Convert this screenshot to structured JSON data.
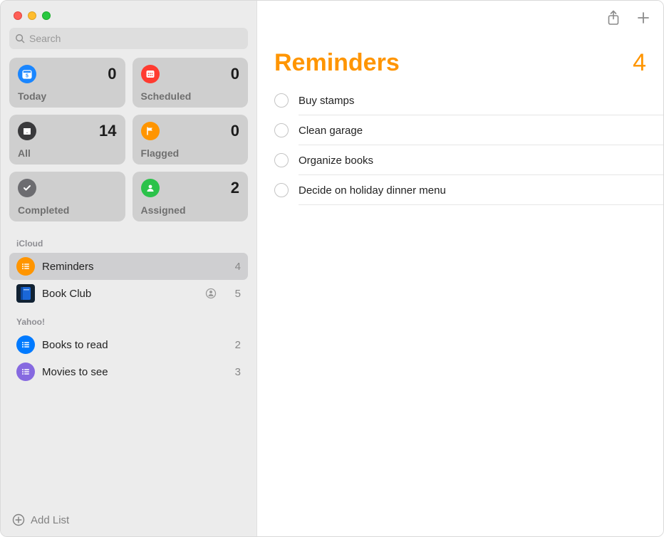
{
  "search": {
    "placeholder": "Search"
  },
  "smart_lists": {
    "today": {
      "label": "Today",
      "count": 0
    },
    "scheduled": {
      "label": "Scheduled",
      "count": 0
    },
    "all": {
      "label": "All",
      "count": 14
    },
    "flagged": {
      "label": "Flagged",
      "count": 0
    },
    "completed": {
      "label": "Completed"
    },
    "assigned": {
      "label": "Assigned",
      "count": 2
    }
  },
  "accounts": [
    {
      "name": "iCloud",
      "lists": [
        {
          "name": "Reminders",
          "count": 4,
          "color": "orange",
          "selected": true,
          "shared": false
        },
        {
          "name": "Book Club",
          "count": 5,
          "color": "darkblue",
          "selected": false,
          "shared": true
        }
      ]
    },
    {
      "name": "Yahoo!",
      "lists": [
        {
          "name": "Books to read",
          "count": 2,
          "color": "blue",
          "selected": false,
          "shared": false
        },
        {
          "name": "Movies to see",
          "count": 3,
          "color": "purple",
          "selected": false,
          "shared": false
        }
      ]
    }
  ],
  "add_list_label": "Add List",
  "main": {
    "title": "Reminders",
    "count": 4,
    "items": [
      {
        "title": "Buy stamps"
      },
      {
        "title": "Clean garage"
      },
      {
        "title": "Organize books"
      },
      {
        "title": "Decide on holiday dinner menu"
      }
    ]
  }
}
